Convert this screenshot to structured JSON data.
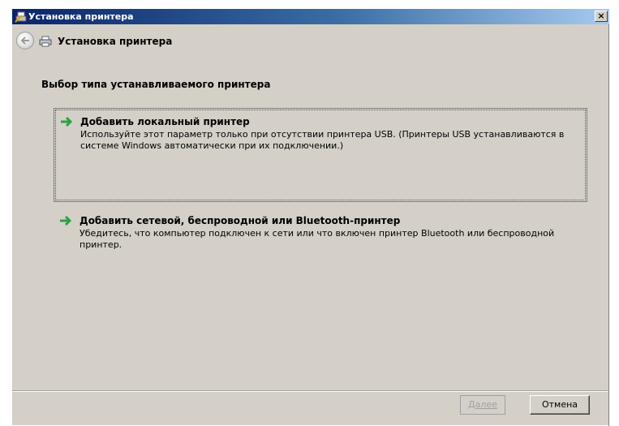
{
  "window": {
    "title": "Установка принтера",
    "close_glyph": "×"
  },
  "nav": {
    "title": "Установка принтера"
  },
  "heading": "Выбор типа устанавливаемого принтера",
  "options": [
    {
      "title": "Добавить локальный принтер",
      "description": "Используйте этот параметр только при отсутствии принтера USB. (Принтеры USB устанавливаются в системе Windows автоматически при их подключении.)",
      "icon": "green-arrow-icon",
      "selected": true
    },
    {
      "title": "Добавить сетевой, беспроводной или Bluetooth-принтер",
      "description": "Убедитесь, что компьютер подключен к сети или что включен принтер Bluetooth или беспроводной принтер.",
      "icon": "green-arrow-icon",
      "selected": false
    }
  ],
  "buttons": {
    "next": "Далее",
    "cancel": "Отмена"
  },
  "colors": {
    "titlebar_start": "#0a246a",
    "titlebar_end": "#a6caf0",
    "window_bg": "#d4d0c8",
    "arrow_green": "#2ea043"
  }
}
